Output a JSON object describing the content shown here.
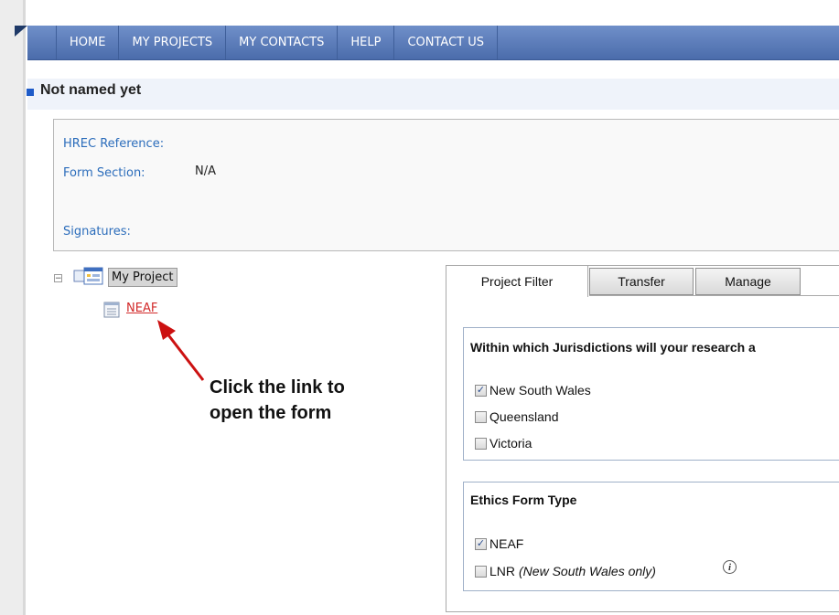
{
  "nav": {
    "items": [
      "HOME",
      "MY PROJECTS",
      "MY CONTACTS",
      "HELP",
      "CONTACT US"
    ]
  },
  "page": {
    "title": "Not named yet"
  },
  "info": {
    "hrec_label": "HREC Reference:",
    "form_section_label": "Form Section:",
    "form_section_value": "N/A",
    "signatures_label": "Signatures:"
  },
  "tree": {
    "project_label": "My Project",
    "form_link": "NEAF"
  },
  "annotation": {
    "line1": "Click the link to",
    "line2": "open the form"
  },
  "tabs": [
    "Project Filter",
    "Transfer",
    "Manage"
  ],
  "jurisdictions": {
    "title": "Within which Jurisdictions will your research a",
    "options": [
      {
        "label": "New South Wales",
        "checked": true
      },
      {
        "label": "Queensland",
        "checked": false
      },
      {
        "label": "Victoria",
        "checked": false
      }
    ]
  },
  "ethics_form": {
    "title": "Ethics Form Type",
    "options": [
      {
        "label": "NEAF",
        "checked": true
      },
      {
        "label": "LNR",
        "note": "(New South Wales only)",
        "checked": false
      }
    ]
  },
  "colors": {
    "nav_bg": "#5b7bbb",
    "link": "#2c6dbb",
    "link_red": "#d22a2a",
    "annotation_arrow": "#cc1111"
  }
}
